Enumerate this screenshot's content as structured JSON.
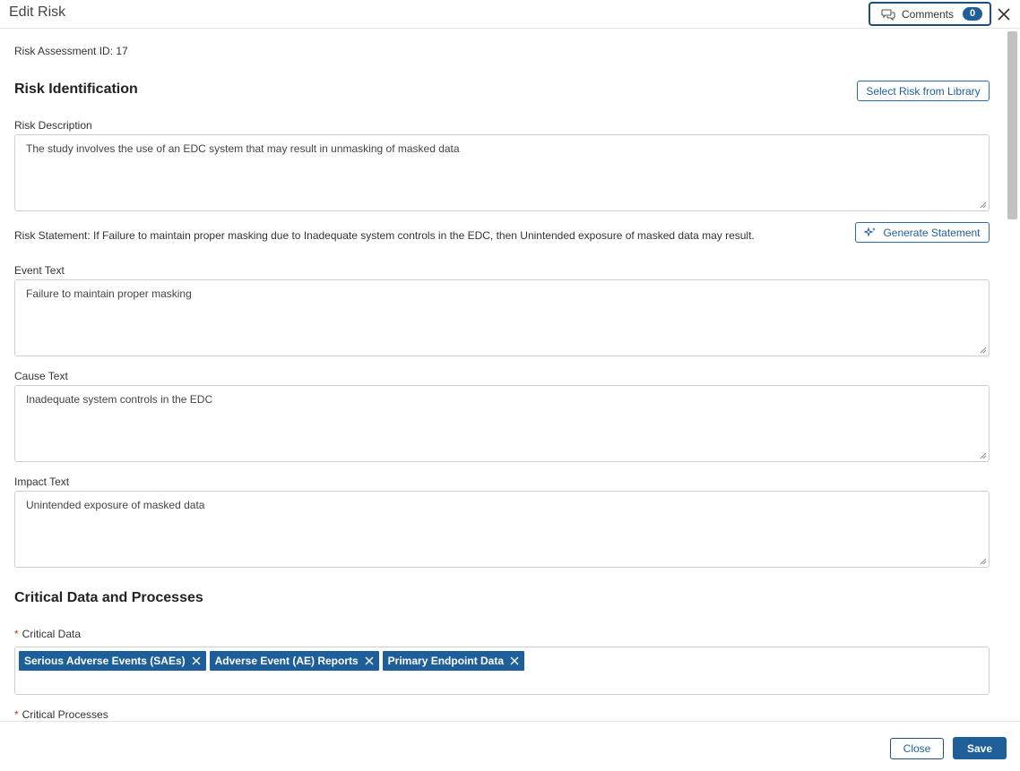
{
  "header": {
    "title": "Edit Risk",
    "comments_label": "Comments",
    "comments_count": "0"
  },
  "form": {
    "assessment_id": "Risk Assessment ID: 17",
    "risk_identification": {
      "heading": "Risk Identification",
      "library_button": "Select Risk from Library"
    },
    "risk_description": {
      "label": "Risk Description",
      "value": "The study involves the use of an EDC system that may result in unmasking of masked data"
    },
    "risk_statement": "Risk Statement: If Failure to maintain proper masking due to Inadequate system controls in the EDC, then Unintended exposure of masked data may result.",
    "generate_button": "Generate Statement",
    "event_text": {
      "label": "Event Text",
      "value": "Failure to maintain proper masking"
    },
    "cause_text": {
      "label": "Cause Text",
      "value": "Inadequate system controls in the EDC"
    },
    "impact_text": {
      "label": "Impact Text",
      "value": "Unintended exposure of masked data"
    },
    "critical_section": {
      "heading": "Critical Data and Processes",
      "critical_data_label": "Critical Data",
      "critical_data_tags": [
        "Serious Adverse Events (SAEs)",
        "Adverse Event (AE) Reports",
        "Primary Endpoint Data"
      ],
      "critical_processes_label": "Critical Processes",
      "required_mark": "*"
    }
  },
  "footer": {
    "close_label": "Close",
    "save_label": "Save"
  },
  "colors": {
    "accent": "#1f5f99",
    "required": "#c0392b"
  }
}
